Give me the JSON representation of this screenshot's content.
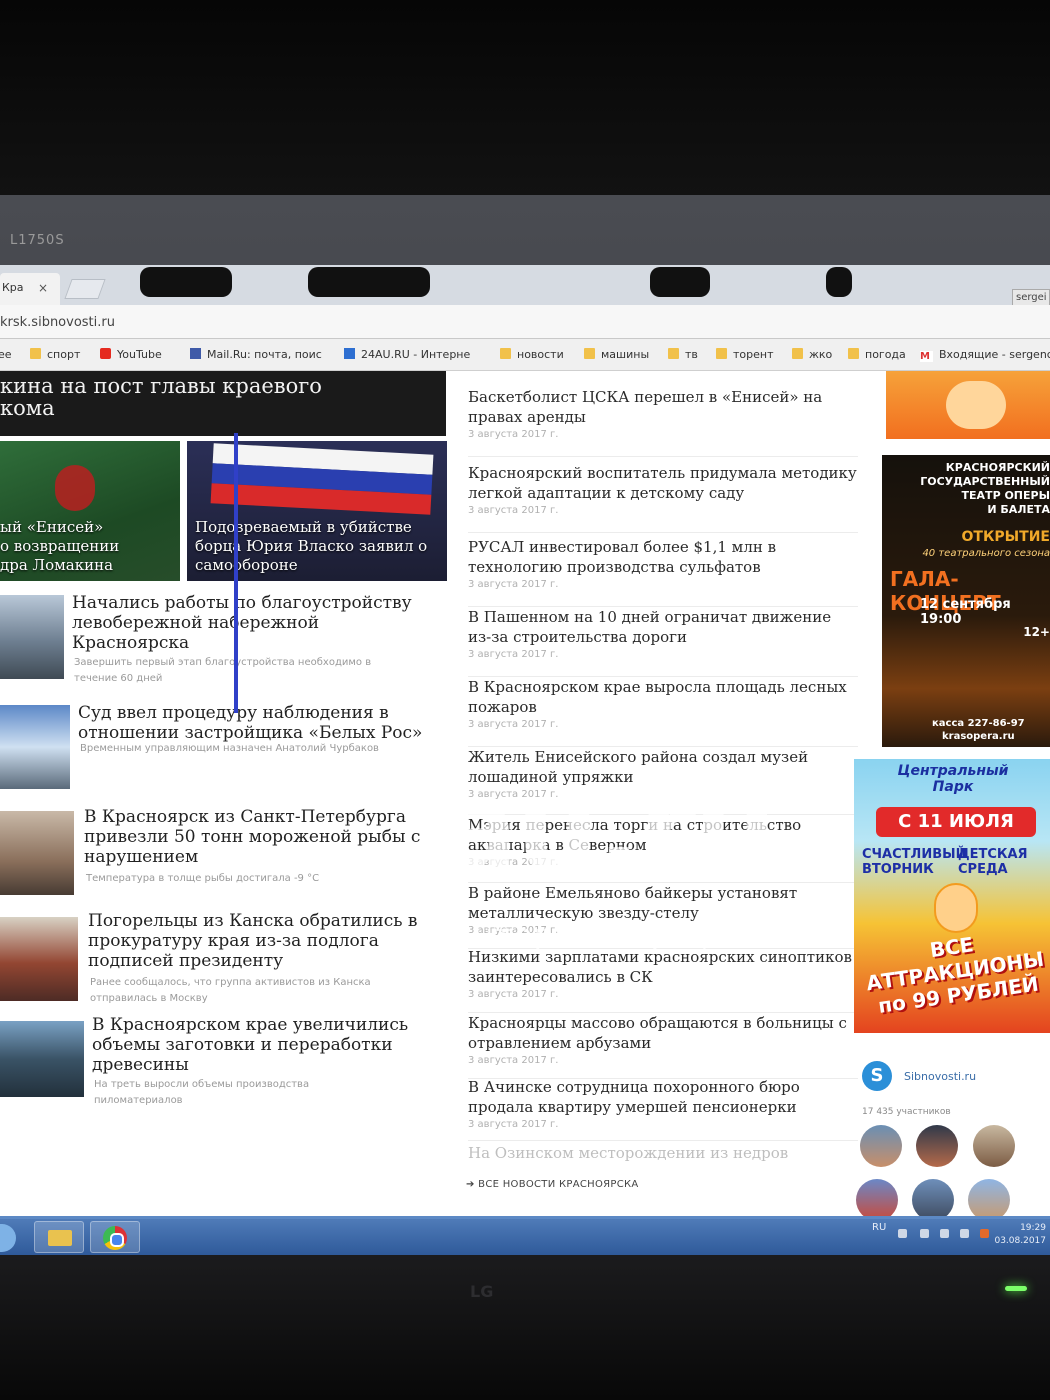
{
  "bezel": {
    "label": "L1750S",
    "brand": "LG"
  },
  "browser": {
    "tab": {
      "title": "Кра",
      "close": "×"
    },
    "user_chip": "sergei",
    "url": "krsk.sibnovosti.ru",
    "bookmarks": [
      {
        "label": "спорт",
        "icon": "folder-icon"
      },
      {
        "label": "YouTube",
        "icon": "youtube-icon"
      },
      {
        "label": "Mail.Ru: почта, поис",
        "icon": "mailru-icon"
      },
      {
        "label": "24AU.RU - Интерне",
        "icon": "24au-icon"
      },
      {
        "label": "новости",
        "icon": "folder-icon"
      },
      {
        "label": "машины",
        "icon": "folder-icon"
      },
      {
        "label": "тв",
        "icon": "folder-icon"
      },
      {
        "label": "торент",
        "icon": "folder-icon"
      },
      {
        "label": "жко",
        "icon": "folder-icon"
      },
      {
        "label": "погода",
        "icon": "folder-icon"
      },
      {
        "label": "Входящие - sergenc",
        "icon": "gmail-icon"
      }
    ]
  },
  "main": {
    "banner_headline": "кина на пост главы краевого\nкома",
    "photo_cards": [
      {
        "caption": "ый «Енисей»\nо возвращении\nдра Ломакина"
      },
      {
        "caption": "Подозреваемый в убийстве\nборца Юрия Власко заявил о\nсамообороне"
      }
    ],
    "news": [
      {
        "title": "Начались работы по благоустройству\nлевобережной набережной\nКрасноярска",
        "summary": "Завершить первый этап благоустройства необходимо в\nтечение 60 дней"
      },
      {
        "title": "Суд ввел процедуру наблюдения в\nотношении застройщика «Белых Рос»",
        "summary": "Временным управляющим назначен Анатолий Чурбаков"
      },
      {
        "title": "В Красноярск из Санкт-Петербурга\nпривезли 50 тонн мороженой рыбы с\nнарушением",
        "summary": "Температура в толще рыбы достигала -9 °С"
      },
      {
        "title": "Погорельцы из Канска обратились в\nпрокуратуру края из-за подлога\nподписей президенту",
        "summary": "Ранее сообщалось, что группа активистов из Канска\nотправилась в Москву"
      },
      {
        "title": "В Красноярском крае увеличились\nобъемы заготовки и переработки\nдревесины",
        "summary": "На треть выросли объемы производства\nпиломатериалов"
      }
    ]
  },
  "feed": {
    "items": [
      {
        "title": "Баскетболист ЦСКА перешел в «Енисей» на правах аренды",
        "date": "3 августа 2017 г."
      },
      {
        "title": "Красноярский воспитатель придумала методику легкой адаптации к детскому саду",
        "date": "3 августа 2017 г."
      },
      {
        "title": "РУСАЛ инвестировал более $1,1 млн в технологию производства сульфатов",
        "date": "3 августа 2017 г."
      },
      {
        "title": "В Пашенном на 10 дней ограничат движение из-за строительства дороги",
        "date": "3 августа 2017 г."
      },
      {
        "title": "В Красноярском крае выросла площадь лесных пожаров",
        "date": "3 августа 2017 г."
      },
      {
        "title": "Житель Енисейского района создал музей лошадиной упряжки",
        "date": "3 августа 2017 г."
      },
      {
        "title": "Мэрия перенесла торги на строительство аквапарка в Северном",
        "date": "3 августа 2017 г."
      },
      {
        "title": "В районе Емельяново байкеры установят металлическую звезду-стелу",
        "date": "3 августа 2017 г."
      },
      {
        "title": "Низкими зарплатами красноярских синоптиков заинтересовались в СК",
        "date": "3 августа 2017 г."
      },
      {
        "title": "Красноярцы массово обращаются в больницы с отравлением арбузами",
        "date": "3 августа 2017 г."
      },
      {
        "title": "В Ачинске сотрудница похоронного бюро продала квартиру умершей пенсионерки",
        "date": "3 августа 2017 г."
      },
      {
        "title": "На Озинском месторождении из недров",
        "date": ""
      }
    ],
    "all_news_link": "➔ ВСЕ НОВОСТИ КРАСНОЯРСКА"
  },
  "sidebar": {
    "opera_ad": {
      "header": "КРАСНОЯРСКИЙ\nГОСУДАРСТВЕННЫЙ\nТЕАТР ОПЕРЫ\nИ БАЛЕТА",
      "opening": "ОТКРЫТИЕ",
      "season": "40 театрального сезона",
      "gala": "ГАЛА-КОНЦЕРТ",
      "date": "12 сентября 19:00",
      "age": "12+",
      "box_office": "касса 227-86-97\nkrasopera.ru"
    },
    "park_ad": {
      "title": "Центральный\nПарк",
      "date": "С 11 ИЮЛЯ",
      "tuesday": "СЧАСТЛИВЫЙ\nВТОРНИК",
      "wednesday": "ДЕТСКАЯ\nСРЕДА",
      "promo": "ВСЕ\nАТТРАКЦИОНЫ\nпо 99 РУБЛЕЙ"
    },
    "community": {
      "logo": "S",
      "name": "Sibnovosti.ru",
      "members": "17 435 участников"
    }
  },
  "watermark": {
    "main": "au.ru",
    "sub": "интернет-аукцион"
  },
  "taskbar": {
    "lang": "RU",
    "time": "19:29",
    "date": "03.08.2017"
  }
}
